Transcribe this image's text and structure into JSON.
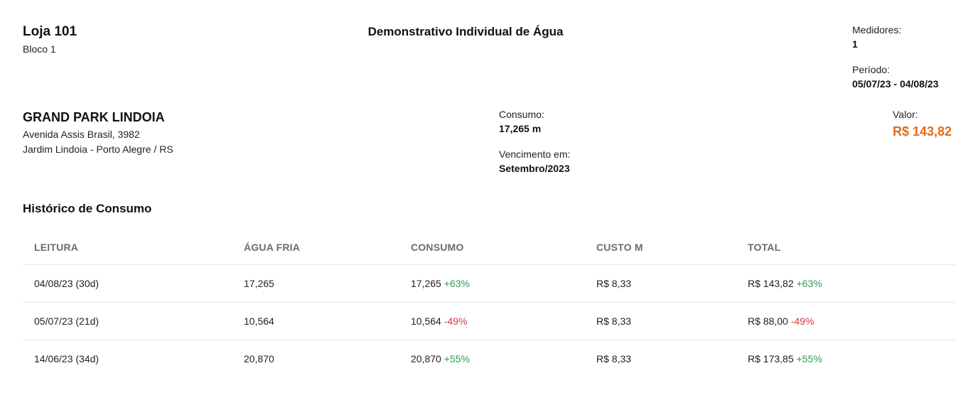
{
  "unit": {
    "name": "Loja 101",
    "block": "Bloco 1"
  },
  "document_title": "Demonstrativo Individual de Água",
  "meta": {
    "medidores_label": "Medidores:",
    "medidores_value": "1",
    "periodo_label": "Período:",
    "periodo_value": "05/07/23 - 04/08/23"
  },
  "condominium": {
    "name": "GRAND PARK LINDOIA",
    "address_line1": "Avenida Assis Brasil, 3982",
    "address_line2": "Jardim Lindoia - Porto Alegre / RS"
  },
  "summary": {
    "consumo_label": "Consumo:",
    "consumo_value": "17,265 m",
    "vencimento_label": "Vencimento em:",
    "vencimento_value": "Setembro/2023",
    "valor_label": "Valor:",
    "valor_value": "R$ 143,82",
    "valor_color": "#e8681a"
  },
  "history": {
    "title": "Histórico de Consumo",
    "columns": [
      "LEITURA",
      "ÁGUA FRIA",
      "CONSUMO",
      "CUSTO M",
      "TOTAL"
    ],
    "rows": [
      {
        "leitura": "04/08/23 (30d)",
        "agua_fria": "17,265",
        "consumo": "17,265",
        "consumo_delta": "+63%",
        "consumo_trend": "up",
        "custo": "R$ 8,33",
        "total": "R$ 143,82",
        "total_delta": "+63%",
        "total_trend": "up"
      },
      {
        "leitura": "05/07/23 (21d)",
        "agua_fria": "10,564",
        "consumo": "10,564",
        "consumo_delta": "-49%",
        "consumo_trend": "down",
        "custo": "R$ 8,33",
        "total": "R$ 88,00",
        "total_delta": "-49%",
        "total_trend": "down"
      },
      {
        "leitura": "14/06/23 (34d)",
        "agua_fria": "20,870",
        "consumo": "20,870",
        "consumo_delta": "+55%",
        "consumo_trend": "up",
        "custo": "R$ 8,33",
        "total": "R$ 173,85",
        "total_delta": "+55%",
        "total_trend": "up"
      }
    ],
    "colors": {
      "up": "#2e9e4f",
      "down": "#d9363e"
    }
  }
}
